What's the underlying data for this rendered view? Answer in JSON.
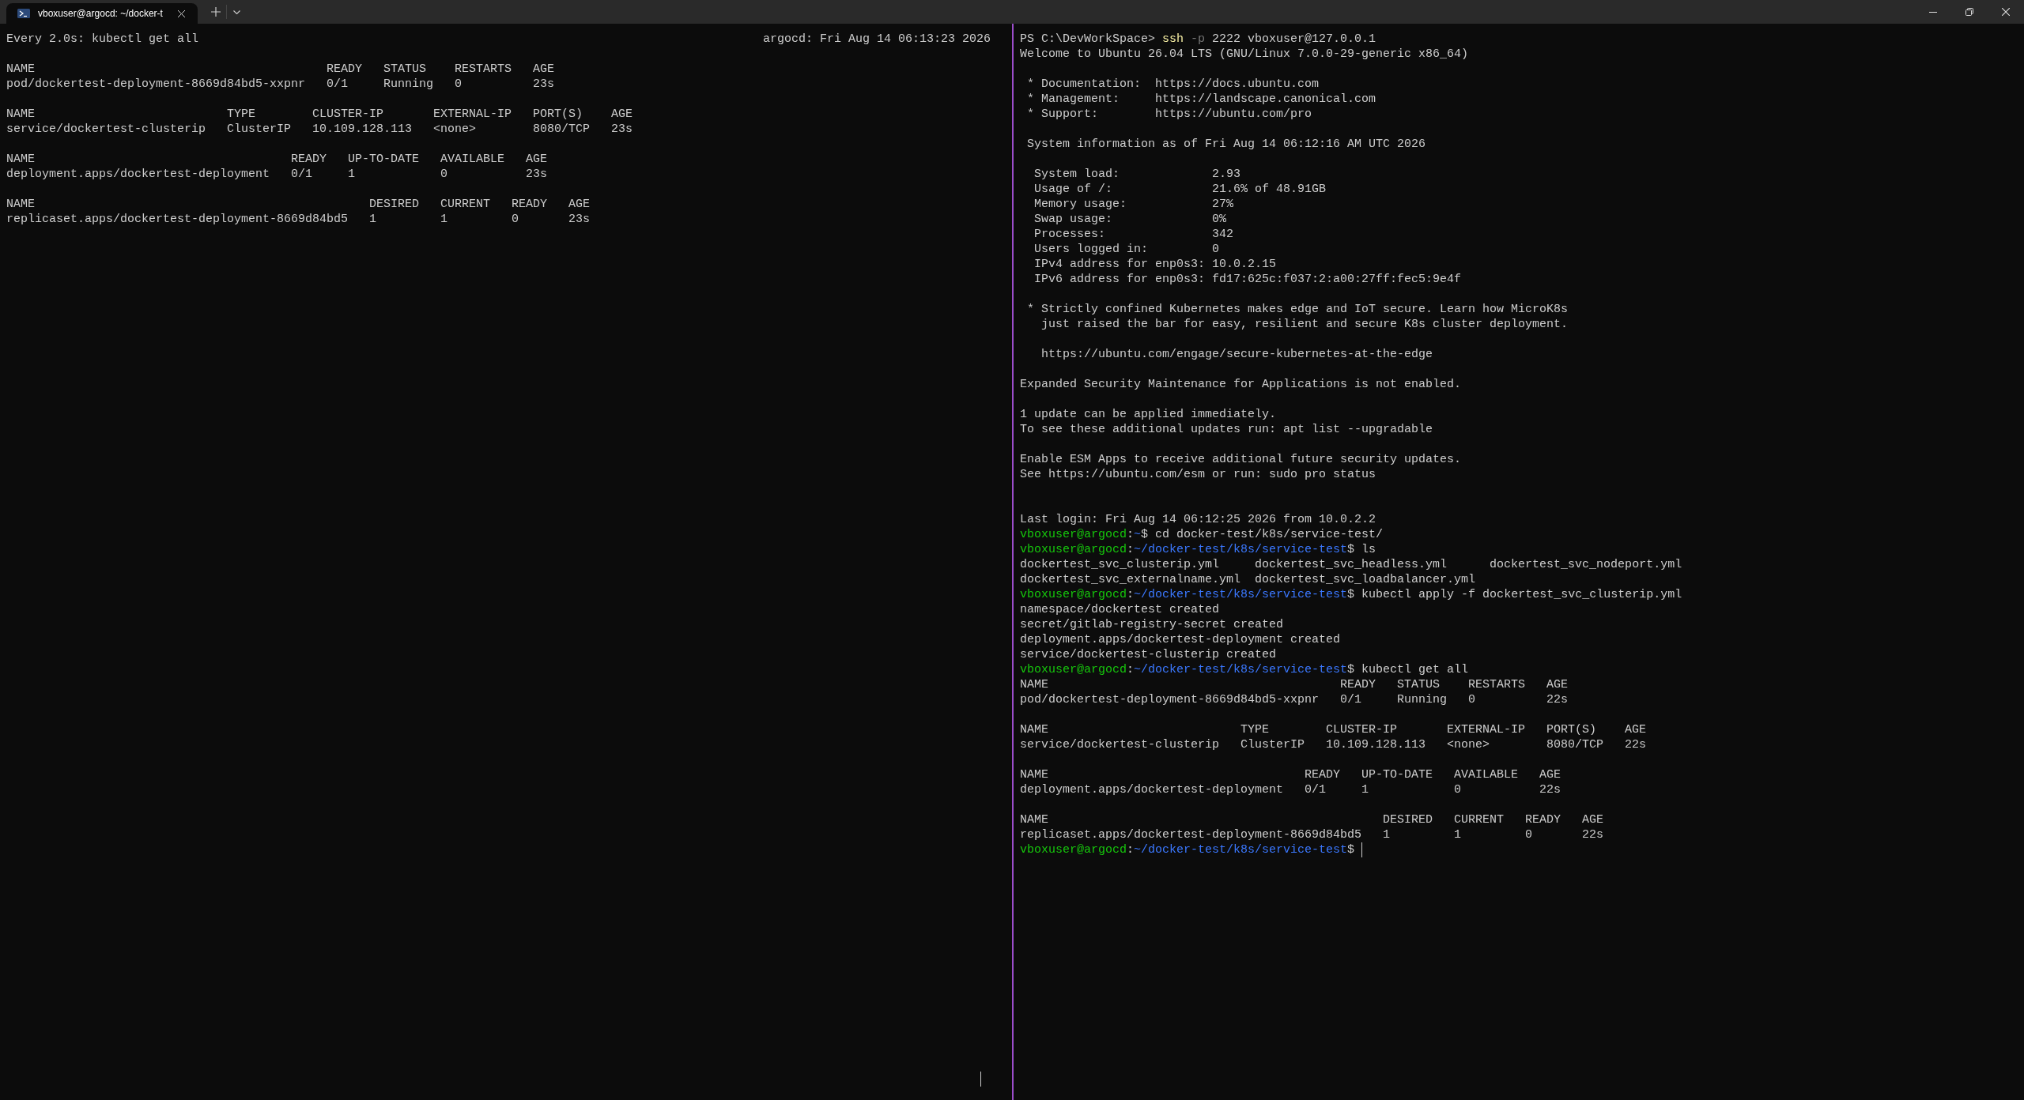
{
  "tabs": [
    {
      "title": "vboxuser@argocd: ~/docker-t",
      "selected": true
    }
  ],
  "left_pane": {
    "lines": [
      {
        "kind": "header",
        "left": "Every 2.0s: kubectl get all",
        "right": "argocd: Fri Aug 14 06:13:23 2026"
      },
      {
        "kind": "blank"
      },
      {
        "kind": "table",
        "columns": [
          "NAME",
          "READY",
          "STATUS",
          "RESTARTS",
          "AGE"
        ],
        "rows": [
          [
            "pod/dockertest-deployment-8669d84bd5-xxpnr",
            "0/1",
            "Running",
            "0",
            "23s"
          ]
        ]
      },
      {
        "kind": "blank"
      },
      {
        "kind": "table",
        "columns": [
          "NAME",
          "TYPE",
          "CLUSTER-IP",
          "EXTERNAL-IP",
          "PORT(S)",
          "AGE"
        ],
        "rows": [
          [
            "service/dockertest-clusterip",
            "ClusterIP",
            "10.109.128.113",
            "<none>",
            "8080/TCP",
            "23s"
          ]
        ]
      },
      {
        "kind": "blank"
      },
      {
        "kind": "table",
        "columns": [
          "NAME",
          "READY",
          "UP-TO-DATE",
          "AVAILABLE",
          "AGE"
        ],
        "rows": [
          [
            "deployment.apps/dockertest-deployment",
            "0/1",
            "1",
            "0",
            "23s"
          ]
        ]
      },
      {
        "kind": "blank"
      },
      {
        "kind": "table",
        "columns": [
          "NAME",
          "DESIRED",
          "CURRENT",
          "READY",
          "AGE"
        ],
        "rows": [
          [
            "replicaset.apps/dockertest-deployment-8669d84bd5",
            "1",
            "1",
            "0",
            "23s"
          ]
        ]
      }
    ]
  },
  "right_pane": {
    "lines": [
      {
        "kind": "text",
        "segments": [
          {
            "kind": "plain",
            "text": "PS C:\\DevWorkSpace> "
          },
          {
            "kind": "command",
            "text": "ssh"
          },
          {
            "kind": "flag",
            "text": " -p"
          },
          {
            "kind": "plain",
            "text": " 2222 vboxuser@127.0.0.1"
          }
        ]
      },
      {
        "kind": "text",
        "segments": [
          {
            "kind": "plain",
            "text": "Welcome to Ubuntu 26.04 LTS (GNU/Linux 7.0.0-29-generic x86_64)"
          }
        ]
      },
      {
        "kind": "blank"
      },
      {
        "kind": "text",
        "segments": [
          {
            "kind": "plain",
            "text": " * Documentation:  https://docs.ubuntu.com"
          }
        ]
      },
      {
        "kind": "text",
        "segments": [
          {
            "kind": "plain",
            "text": " * Management:     https://landscape.canonical.com"
          }
        ]
      },
      {
        "kind": "text",
        "segments": [
          {
            "kind": "plain",
            "text": " * Support:        https://ubuntu.com/pro"
          }
        ]
      },
      {
        "kind": "blank"
      },
      {
        "kind": "text",
        "segments": [
          {
            "kind": "plain",
            "text": " System information as of Fri Aug 14 06:12:16 AM UTC 2026"
          }
        ]
      },
      {
        "kind": "blank"
      },
      {
        "kind": "text",
        "segments": [
          {
            "kind": "plain",
            "text": "  System load:             2.93"
          }
        ]
      },
      {
        "kind": "text",
        "segments": [
          {
            "kind": "plain",
            "text": "  Usage of /:              21.6% of 48.91GB"
          }
        ]
      },
      {
        "kind": "text",
        "segments": [
          {
            "kind": "plain",
            "text": "  Memory usage:            27%"
          }
        ]
      },
      {
        "kind": "text",
        "segments": [
          {
            "kind": "plain",
            "text": "  Swap usage:              0%"
          }
        ]
      },
      {
        "kind": "text",
        "segments": [
          {
            "kind": "plain",
            "text": "  Processes:               342"
          }
        ]
      },
      {
        "kind": "text",
        "segments": [
          {
            "kind": "plain",
            "text": "  Users logged in:         0"
          }
        ]
      },
      {
        "kind": "text",
        "segments": [
          {
            "kind": "plain",
            "text": "  IPv4 address for enp0s3: 10.0.2.15"
          }
        ]
      },
      {
        "kind": "text",
        "segments": [
          {
            "kind": "plain",
            "text": "  IPv6 address for enp0s3: fd17:625c:f037:2:a00:27ff:fec5:9e4f"
          }
        ]
      },
      {
        "kind": "blank"
      },
      {
        "kind": "text",
        "segments": [
          {
            "kind": "plain",
            "text": " * Strictly confined Kubernetes makes edge and IoT secure. Learn how MicroK8s"
          }
        ]
      },
      {
        "kind": "text",
        "segments": [
          {
            "kind": "plain",
            "text": "   just raised the bar for easy, resilient and secure K8s cluster deployment."
          }
        ]
      },
      {
        "kind": "blank"
      },
      {
        "kind": "text",
        "segments": [
          {
            "kind": "plain",
            "text": "   https://ubuntu.com/engage/secure-kubernetes-at-the-edge"
          }
        ]
      },
      {
        "kind": "blank"
      },
      {
        "kind": "text",
        "segments": [
          {
            "kind": "plain",
            "text": "Expanded Security Maintenance for Applications is not enabled."
          }
        ]
      },
      {
        "kind": "blank"
      },
      {
        "kind": "text",
        "segments": [
          {
            "kind": "plain",
            "text": "1 update can be applied immediately."
          }
        ]
      },
      {
        "kind": "text",
        "segments": [
          {
            "kind": "plain",
            "text": "To see these additional updates run: apt list --upgradable"
          }
        ]
      },
      {
        "kind": "blank"
      },
      {
        "kind": "text",
        "segments": [
          {
            "kind": "plain",
            "text": "Enable ESM Apps to receive additional future security updates."
          }
        ]
      },
      {
        "kind": "text",
        "segments": [
          {
            "kind": "plain",
            "text": "See https://ubuntu.com/esm or run: sudo pro status"
          }
        ]
      },
      {
        "kind": "blank"
      },
      {
        "kind": "blank"
      },
      {
        "kind": "text",
        "segments": [
          {
            "kind": "plain",
            "text": "Last login: Fri Aug 14 06:12:25 2026 from 10.0.2.2"
          }
        ]
      },
      {
        "kind": "text",
        "segments": [
          {
            "kind": "user",
            "text": "vboxuser@argocd"
          },
          {
            "kind": "plain",
            "text": ":"
          },
          {
            "kind": "path",
            "text": "~"
          },
          {
            "kind": "plain",
            "text": "$ cd docker-test/k8s/service-test/"
          }
        ]
      },
      {
        "kind": "text",
        "segments": [
          {
            "kind": "user",
            "text": "vboxuser@argocd"
          },
          {
            "kind": "plain",
            "text": ":"
          },
          {
            "kind": "path",
            "text": "~/docker-test/k8s/service-test"
          },
          {
            "kind": "plain",
            "text": "$ ls"
          }
        ]
      },
      {
        "kind": "text",
        "segments": [
          {
            "kind": "plain",
            "text": "dockertest_svc_clusterip.yml     dockertest_svc_headless.yml      dockertest_svc_nodeport.yml"
          }
        ]
      },
      {
        "kind": "text",
        "segments": [
          {
            "kind": "plain",
            "text": "dockertest_svc_externalname.yml  dockertest_svc_loadbalancer.yml"
          }
        ]
      },
      {
        "kind": "text",
        "segments": [
          {
            "kind": "user",
            "text": "vboxuser@argocd"
          },
          {
            "kind": "plain",
            "text": ":"
          },
          {
            "kind": "path",
            "text": "~/docker-test/k8s/service-test"
          },
          {
            "kind": "plain",
            "text": "$ kubectl apply -f dockertest_svc_clusterip.yml"
          }
        ]
      },
      {
        "kind": "text",
        "segments": [
          {
            "kind": "plain",
            "text": "namespace/dockertest created"
          }
        ]
      },
      {
        "kind": "text",
        "segments": [
          {
            "kind": "plain",
            "text": "secret/gitlab-registry-secret created"
          }
        ]
      },
      {
        "kind": "text",
        "segments": [
          {
            "kind": "plain",
            "text": "deployment.apps/dockertest-deployment created"
          }
        ]
      },
      {
        "kind": "text",
        "segments": [
          {
            "kind": "plain",
            "text": "service/dockertest-clusterip created"
          }
        ]
      },
      {
        "kind": "text",
        "segments": [
          {
            "kind": "user",
            "text": "vboxuser@argocd"
          },
          {
            "kind": "plain",
            "text": ":"
          },
          {
            "kind": "path",
            "text": "~/docker-test/k8s/service-test"
          },
          {
            "kind": "plain",
            "text": "$ kubectl get all"
          }
        ]
      },
      {
        "kind": "table",
        "columns": [
          "NAME",
          "READY",
          "STATUS",
          "RESTARTS",
          "AGE"
        ],
        "rows": [
          [
            "pod/dockertest-deployment-8669d84bd5-xxpnr",
            "0/1",
            "Running",
            "0",
            "22s"
          ]
        ]
      },
      {
        "kind": "blank"
      },
      {
        "kind": "table",
        "columns": [
          "NAME",
          "TYPE",
          "CLUSTER-IP",
          "EXTERNAL-IP",
          "PORT(S)",
          "AGE"
        ],
        "rows": [
          [
            "service/dockertest-clusterip",
            "ClusterIP",
            "10.109.128.113",
            "<none>",
            "8080/TCP",
            "22s"
          ]
        ]
      },
      {
        "kind": "blank"
      },
      {
        "kind": "table",
        "columns": [
          "NAME",
          "READY",
          "UP-TO-DATE",
          "AVAILABLE",
          "AGE"
        ],
        "rows": [
          [
            "deployment.apps/dockertest-deployment",
            "0/1",
            "1",
            "0",
            "22s"
          ]
        ]
      },
      {
        "kind": "blank"
      },
      {
        "kind": "table",
        "columns": [
          "NAME",
          "DESIRED",
          "CURRENT",
          "READY",
          "AGE"
        ],
        "rows": [
          [
            "replicaset.apps/dockertest-deployment-8669d84bd5",
            "1",
            "1",
            "0",
            "22s"
          ]
        ]
      },
      {
        "kind": "text",
        "cursor": true,
        "segments": [
          {
            "kind": "user",
            "text": "vboxuser@argocd"
          },
          {
            "kind": "plain",
            "text": ":"
          },
          {
            "kind": "path",
            "text": "~/docker-test/k8s/service-test"
          },
          {
            "kind": "plain",
            "text": "$ "
          }
        ]
      }
    ]
  }
}
